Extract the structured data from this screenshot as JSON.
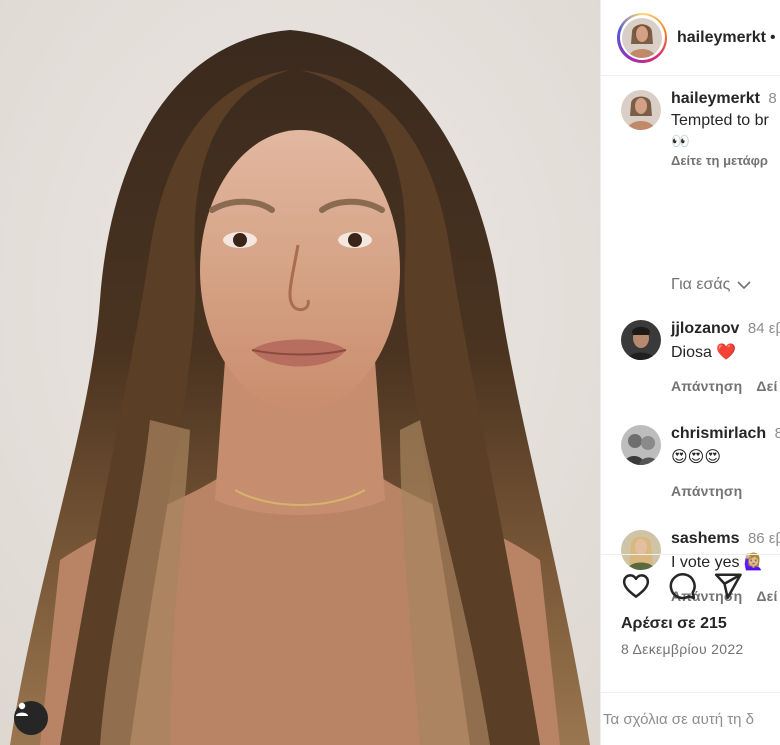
{
  "post": {
    "author": "haileymerkt",
    "header_dot": "•",
    "caption": {
      "username": "haileymerkt",
      "timestamp": "8",
      "text": "Tempted to br",
      "emoji": "👀",
      "translate": "Δείτε τη μετάφρ"
    },
    "for_you_label": "Για εσάς"
  },
  "comments": [
    {
      "username": "jjlozanov",
      "timestamp": "84 εβ",
      "text": "Diosa ❤️",
      "reply": "Απάντηση",
      "extra": "Δεί"
    },
    {
      "username": "chrismirlach",
      "timestamp": "8",
      "text": "😍😍😍",
      "reply": "Απάντηση",
      "extra": ""
    },
    {
      "username": "sashems",
      "timestamp": "86 εβ",
      "text": "I vote yes 🙋🏼‍♀️",
      "reply": "Απάντηση",
      "extra": "Δεί"
    }
  ],
  "actions": {
    "likes": "Αρέσει σε 215",
    "date": "8 Δεκεμβρίου 2022",
    "icons": [
      "heart-icon",
      "comment-icon",
      "share-icon"
    ]
  },
  "comment_input": {
    "placeholder": "Τα σχόλια σε αυτή τη δ"
  },
  "colors": {
    "text": "#262626",
    "secondary": "#737373",
    "border": "#efefef"
  }
}
